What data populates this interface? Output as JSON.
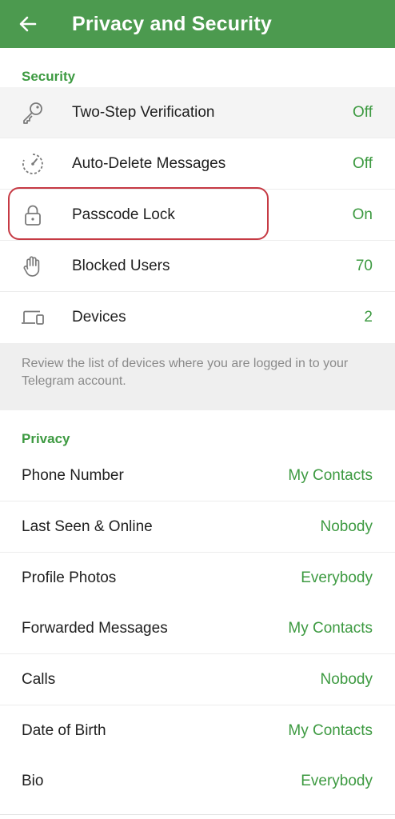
{
  "header": {
    "title": "Privacy and Security",
    "back_icon": "arrow-left-icon",
    "color": "#4c9a4f"
  },
  "security": {
    "title": "Security",
    "items": [
      {
        "label": "Two-Step Verification",
        "value": "Off",
        "icon": "key-icon"
      },
      {
        "label": "Auto-Delete Messages",
        "value": "Off",
        "icon": "timer-icon"
      },
      {
        "label": "Passcode Lock",
        "value": "On",
        "icon": "lock-icon"
      },
      {
        "label": "Blocked Users",
        "value": "70",
        "icon": "hand-icon"
      },
      {
        "label": "Devices",
        "value": "2",
        "icon": "devices-icon"
      }
    ],
    "info": "Review the list of devices where you are logged in to your Telegram account."
  },
  "privacy": {
    "title": "Privacy",
    "items": [
      {
        "label": "Phone Number",
        "value": "My Contacts"
      },
      {
        "label": "Last Seen & Online",
        "value": "Nobody"
      },
      {
        "label": "Profile Photos",
        "value": "Everybody"
      },
      {
        "label": "Forwarded Messages",
        "value": "My Contacts"
      },
      {
        "label": "Calls",
        "value": "Nobody"
      },
      {
        "label": "Date of Birth",
        "value": "My Contacts"
      },
      {
        "label": "Bio",
        "value": "Everybody"
      }
    ]
  },
  "colors": {
    "accent": "#3d9a41",
    "highlight": "#c63a44"
  }
}
